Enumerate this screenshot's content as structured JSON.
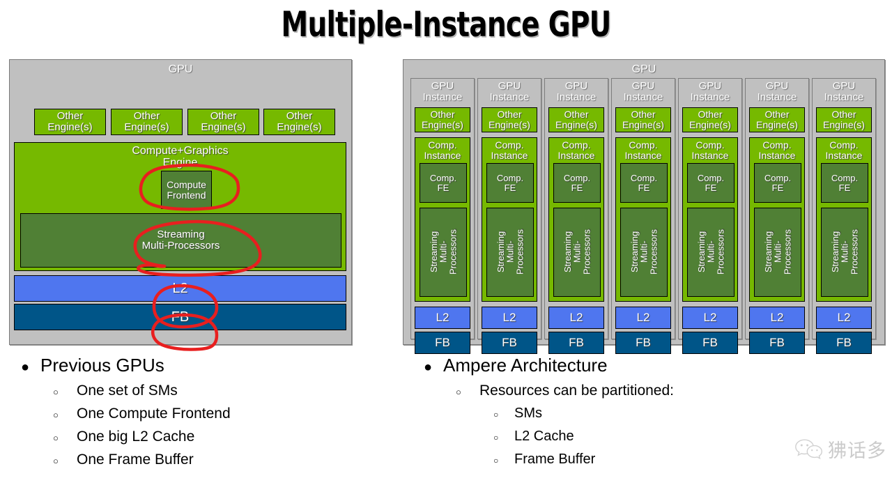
{
  "slide": {
    "title": "Multiple-Instance GPU"
  },
  "colors": {
    "nvidia_green": "#76b900",
    "dark_green": "#508035",
    "l2_blue": "#4f76ef",
    "fb_blue": "#005588",
    "panel_gray": "#c0c0c0",
    "annotation_red": "#e81f1f"
  },
  "left_diagram": {
    "name": "previous-gpu-diagram",
    "panel_label": "GPU",
    "other_engines": [
      "Other\nEngine(s)",
      "Other\nEngine(s)",
      "Other\nEngine(s)",
      "Other\nEngine(s)"
    ],
    "compute_graphics_engine_label": "Compute+Graphics\nEngine",
    "compute_frontend_label": "Compute\nFrontend",
    "streaming_mp_label": "Streaming\nMulti-Processors",
    "l2_label": "L2",
    "fb_label": "FB"
  },
  "right_diagram": {
    "name": "mig-gpu-diagram",
    "panel_label": "GPU",
    "instance_count": 7,
    "instance": {
      "header_label": "GPU\nInstance",
      "other_engines_label": "Other\nEngine(s)",
      "comp_instance_label": "Comp.\nInstance",
      "comp_fe_label": "Comp.\nFE",
      "streaming_mp_label": "Streaming\nMulti-\nProcessors",
      "l2_label": "L2",
      "fb_label": "FB"
    }
  },
  "annotations": {
    "circles": [
      {
        "target": "compute-frontend",
        "label": "Compute Frontend"
      },
      {
        "target": "streaming-multi-processors",
        "label": "Streaming Multi-Processors"
      },
      {
        "target": "l2",
        "label": "L2"
      },
      {
        "target": "fb",
        "label": "FB"
      }
    ]
  },
  "left_bullets": {
    "heading": "Previous GPUs",
    "items": [
      "One set of SMs",
      "One Compute  Frontend",
      "One big L2 Cache",
      "One Frame Buffer"
    ]
  },
  "right_bullets": {
    "heading": "Ampere Architecture",
    "sub_heading": "Resources can be partitioned:",
    "items": [
      "SMs",
      "L2 Cache",
      "Frame Buffer"
    ]
  },
  "watermark": {
    "icon": "wechat-icon",
    "text": "狒话多"
  },
  "markers": {
    "filled_disc": "●",
    "hollow_circle": "○"
  }
}
